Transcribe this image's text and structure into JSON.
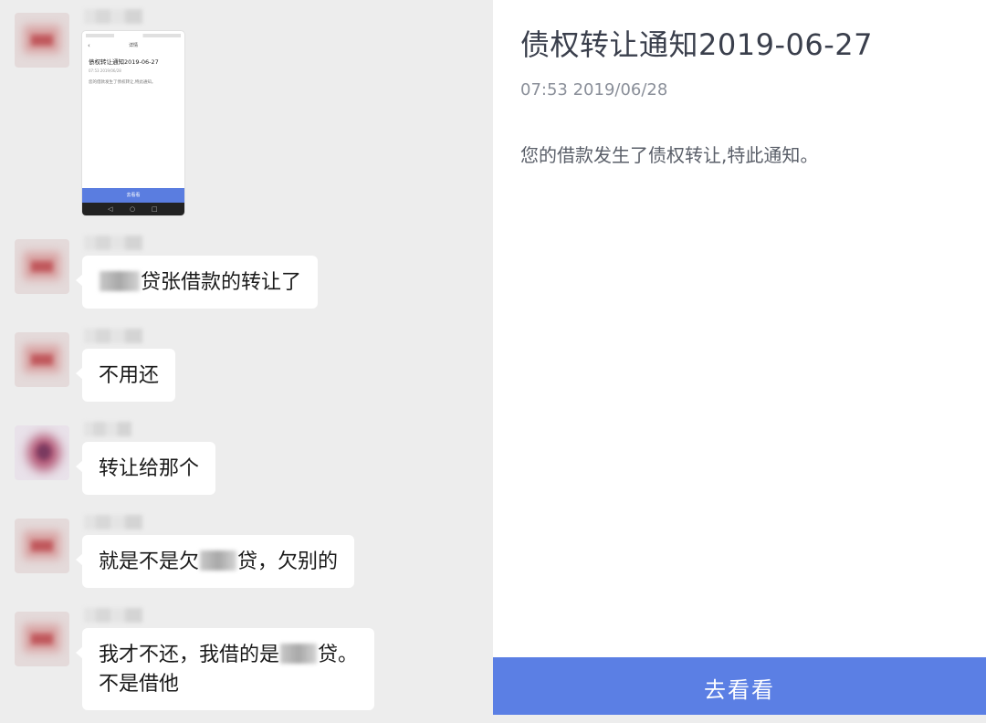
{
  "chat": {
    "thumbnail": {
      "nav_title": "详情",
      "title": "债权转让通知2019-06-27",
      "time": "07:53 2019/06/28",
      "body": "您的借款发生了债权转让,特此通知。",
      "button": "去看看"
    },
    "messages": [
      {
        "parts": [
          "",
          "贷张借款的转让了"
        ]
      },
      {
        "text": "不用还"
      },
      {
        "text": "转让给那个"
      },
      {
        "parts": [
          "就是不是欠",
          "贷，欠别的"
        ]
      },
      {
        "parts": [
          "我才不还，我借的是",
          "贷。"
        ],
        "line2": "不是借他"
      }
    ]
  },
  "detail": {
    "title": "债权转让通知2019-06-27",
    "time": "07:53 2019/06/28",
    "body": "您的借款发生了债权转让,特此通知。",
    "button": "去看看"
  },
  "colors": {
    "accent": "#5b7fe4",
    "chat_bg": "#ededed",
    "bubble": "#ffffff"
  }
}
